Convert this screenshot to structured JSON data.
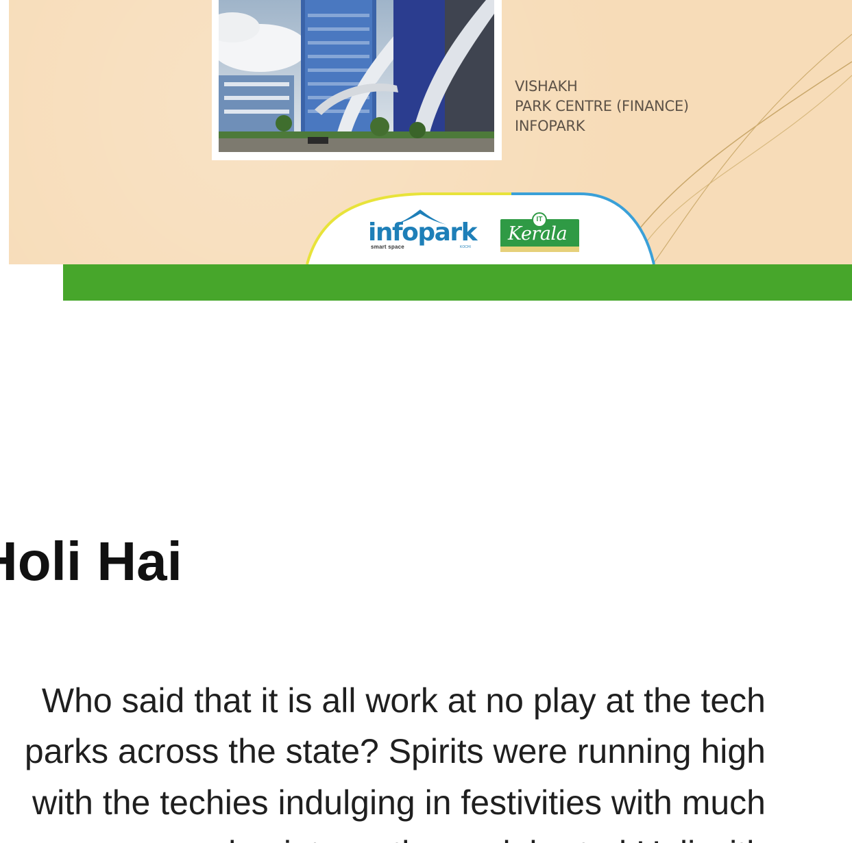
{
  "banner": {
    "caption_lines": [
      "VISHAKH",
      "PARK CENTRE (FINANCE)",
      "INFOPARK"
    ],
    "logos": {
      "infopark": "infopark",
      "infopark_tagline": "smart space",
      "infopark_city": "KOCHI",
      "kerala": "Kerala",
      "kerala_badge": "IT"
    }
  },
  "article": {
    "title": "Holi Hai",
    "body_lines": [
      "Who said that it is all work at no play at the tech",
      "parks across the state? Spirits were running high",
      "with the techies indulging in festivities with much",
      "pomp and gaiety as they celebrated Holi with"
    ]
  },
  "colors": {
    "banner_bg": "#f7dcb8",
    "accent_green": "#47a62b",
    "infopark_blue": "#1e7fb8",
    "kerala_green": "#2f9a45"
  }
}
